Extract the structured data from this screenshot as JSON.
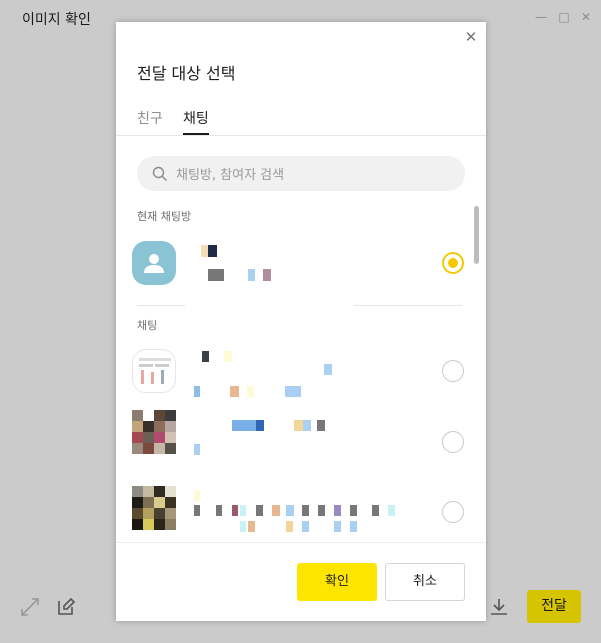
{
  "window": {
    "title": "이미지 확인",
    "send_label": "전달"
  },
  "modal": {
    "title": "전달 대상 선택",
    "tabs": [
      {
        "label": "친구",
        "active": false
      },
      {
        "label": "채팅",
        "active": true
      }
    ],
    "search": {
      "placeholder": "채팅방, 참여자 검색"
    },
    "sections": {
      "current": "현재 채팅방",
      "chats": "채팅"
    },
    "rows": [
      {
        "section": "current",
        "selected": true
      },
      {
        "section": "chats",
        "selected": false
      },
      {
        "section": "chats",
        "selected": false
      },
      {
        "section": "chats",
        "selected": false
      }
    ],
    "confirm_label": "확인",
    "cancel_label": "취소"
  },
  "colors": {
    "accent": "#fee500",
    "radio_selected": "#f5c800",
    "send_button": "#d6c400",
    "default_avatar": "#8ac3d3"
  }
}
